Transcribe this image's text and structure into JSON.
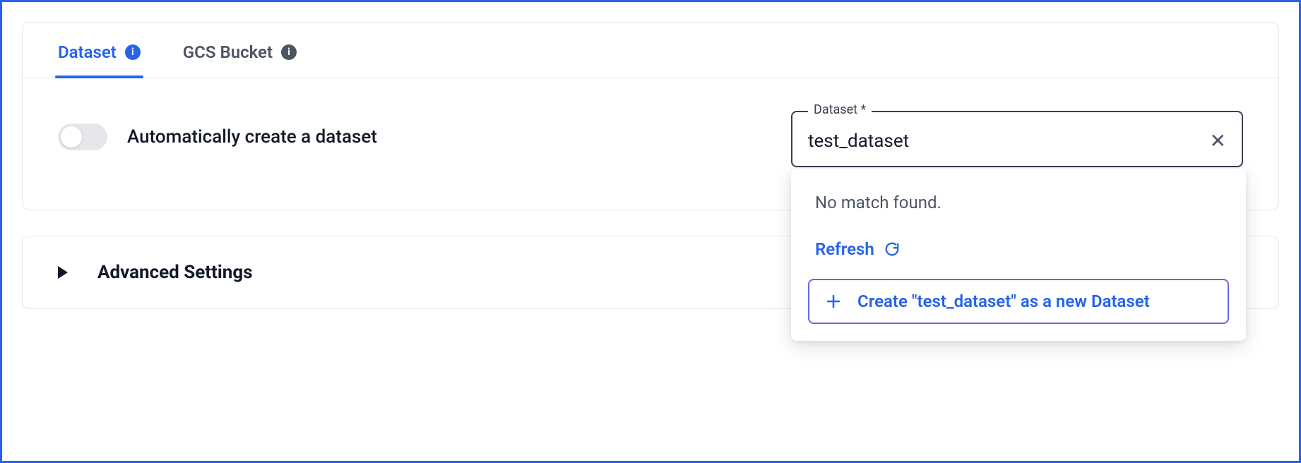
{
  "tabs": {
    "dataset": "Dataset",
    "gcs": "GCS Bucket"
  },
  "auto_create": {
    "label": "Automatically create a dataset",
    "enabled": false
  },
  "dataset_field": {
    "label": "Dataset *",
    "value": "test_dataset"
  },
  "dropdown": {
    "no_match": "No match found.",
    "refresh": "Refresh",
    "create_label": "Create \"test_dataset\" as a new Dataset"
  },
  "advanced": {
    "label": "Advanced Settings"
  }
}
